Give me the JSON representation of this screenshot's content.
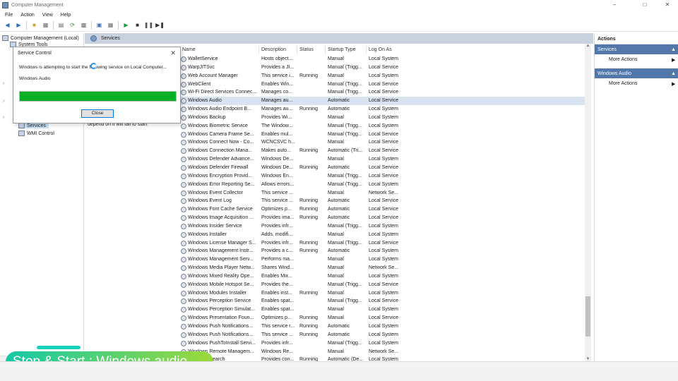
{
  "window": {
    "title": "Computer Management"
  },
  "menu": [
    "File",
    "Action",
    "View",
    "Help"
  ],
  "tree": {
    "root": "Computer Management (Local)",
    "system_tools": "System Tools",
    "services": "Services",
    "wmi": "WMI Control"
  },
  "center": {
    "header": "Services"
  },
  "columns": {
    "name": "Name",
    "description": "Description",
    "status": "Status",
    "startup": "Startup Type",
    "logon": "Log On As"
  },
  "services": [
    [
      "WalletService",
      "Hosts object...",
      "",
      "Manual",
      "Local System"
    ],
    [
      "WarpJITSvc",
      "Provides a JI...",
      "",
      "Manual (Trigg...",
      "Local Service"
    ],
    [
      "Web Account Manager",
      "This service i...",
      "Running",
      "Manual",
      "Local System"
    ],
    [
      "WebClient",
      "Enables Win...",
      "",
      "Manual (Trigg...",
      "Local Service"
    ],
    [
      "Wi-Fi Direct Services Connec...",
      "Manages co...",
      "",
      "Manual (Trigg...",
      "Local Service"
    ],
    [
      "Windows Audio",
      "Manages au...",
      "",
      "Automatic",
      "Local Service"
    ],
    [
      "Windows Audio Endpoint B...",
      "Manages au...",
      "Running",
      "Automatic",
      "Local System"
    ],
    [
      "Windows Backup",
      "Provides Wi...",
      "",
      "Manual",
      "Local System"
    ],
    [
      "Windows Biometric Service",
      "The Window...",
      "",
      "Manual (Trigg...",
      "Local System"
    ],
    [
      "Windows Camera Frame Se...",
      "Enables mul...",
      "",
      "Manual (Trigg...",
      "Local Service"
    ],
    [
      "Windows Connect Now - Co...",
      "WCNCSVC h...",
      "",
      "Manual",
      "Local Service"
    ],
    [
      "Windows Connection Mana...",
      "Makes auto...",
      "Running",
      "Automatic (Tri...",
      "Local Service"
    ],
    [
      "Windows Defender Advance...",
      "Windows De...",
      "",
      "Manual",
      "Local System"
    ],
    [
      "Windows Defender Firewall",
      "Windows De...",
      "Running",
      "Automatic",
      "Local Service"
    ],
    [
      "Windows Encryption Provid...",
      "Windows En...",
      "",
      "Manual (Trigg...",
      "Local Service"
    ],
    [
      "Windows Error Reporting Se...",
      "Allows errors...",
      "",
      "Manual (Trigg...",
      "Local System"
    ],
    [
      "Windows Event Collector",
      "This service ...",
      "",
      "Manual",
      "Network Se..."
    ],
    [
      "Windows Event Log",
      "This service ...",
      "Running",
      "Automatic",
      "Local Service"
    ],
    [
      "Windows Font Cache Service",
      "Optimizes p...",
      "Running",
      "Automatic",
      "Local Service"
    ],
    [
      "Windows Image Acquisition ...",
      "Provides ima...",
      "Running",
      "Automatic",
      "Local Service"
    ],
    [
      "Windows Insider Service",
      "Provides infr...",
      "",
      "Manual (Trigg...",
      "Local System"
    ],
    [
      "Windows Installer",
      "Adds, modifi...",
      "",
      "Manual",
      "Local System"
    ],
    [
      "Windows License Manager S...",
      "Provides infr...",
      "Running",
      "Manual (Trigg...",
      "Local Service"
    ],
    [
      "Windows Management Instr...",
      "Provides a c...",
      "Running",
      "Automatic",
      "Local System"
    ],
    [
      "Windows Management Serv...",
      "Performs ma...",
      "",
      "Manual",
      "Local System"
    ],
    [
      "Windows Media Player Netw...",
      "Shares Wind...",
      "",
      "Manual",
      "Network Se..."
    ],
    [
      "Windows Mixed Reality Ope...",
      "Enables Mix...",
      "",
      "Manual",
      "Local System"
    ],
    [
      "Windows Mobile Hotspot Se...",
      "Provides the...",
      "",
      "Manual (Trigg...",
      "Local Service"
    ],
    [
      "Windows Modules Installer",
      "Enables inst...",
      "Running",
      "Manual",
      "Local System"
    ],
    [
      "Windows Perception Service",
      "Enables spat...",
      "",
      "Manual (Trigg...",
      "Local Service"
    ],
    [
      "Windows Perception Simulat...",
      "Enables spat...",
      "",
      "Manual",
      "Local System"
    ],
    [
      "Windows Presentation Foun...",
      "Optimizes p...",
      "Running",
      "Manual",
      "Local Service"
    ],
    [
      "Windows Push Notifications...",
      "This service r...",
      "Running",
      "Automatic",
      "Local System"
    ],
    [
      "Windows Push Notifications...",
      "This service ...",
      "Running",
      "Automatic",
      "Local System"
    ],
    [
      "Windows PushToInstall Servi...",
      "Provides infr...",
      "",
      "Manual (Trigg...",
      "Local System"
    ],
    [
      "Windows Remote Managem...",
      "Windows Re...",
      "",
      "Manual",
      "Network Se..."
    ],
    [
      "Windows Search",
      "Provides con...",
      "Running",
      "Automatic (De...",
      "Local System"
    ]
  ],
  "actions": {
    "title": "Actions",
    "section1": "Services",
    "more1": "More Actions",
    "section2": "Windows Audio",
    "more2": "More Actions"
  },
  "dialog": {
    "title": "Service Control",
    "message": "Windows is attempting to start the following service on Local Computer...",
    "service": "Windows Audio",
    "progress": 1.0,
    "close_label": "Close"
  },
  "behind_text": "depend on it will fail to start",
  "caption": "Stop & Start : Windows audio"
}
